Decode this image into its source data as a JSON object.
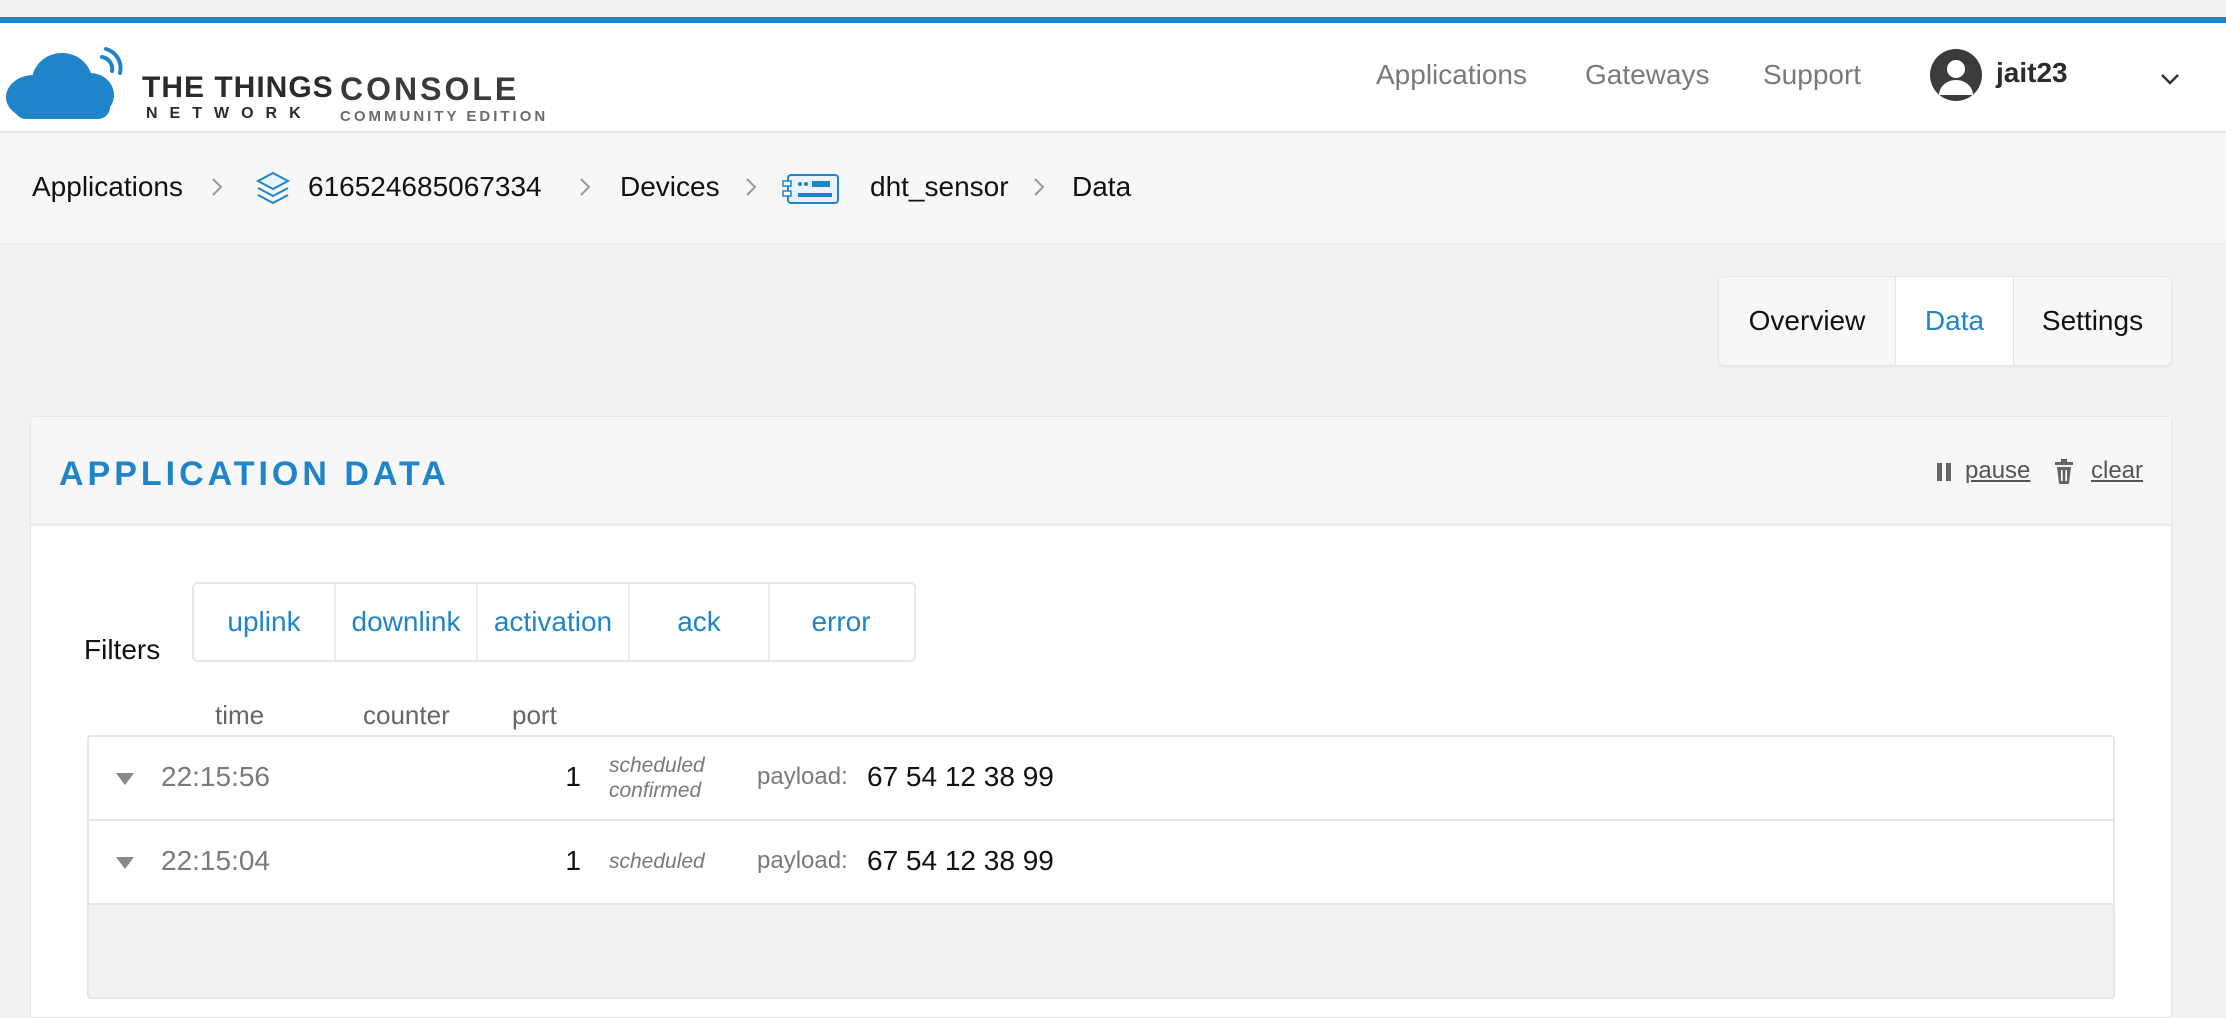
{
  "colors": {
    "accent": "#1f85c8",
    "text": "#111111",
    "muted": "#7a7a7a",
    "page_bg": "#f2f2f2"
  },
  "brand": {
    "line1": "THE THINGS",
    "line2": "NETWORK",
    "product": "CONSOLE",
    "edition": "COMMUNITY EDITION",
    "icon": "ttn-cloud-logo-icon"
  },
  "nav": {
    "items": [
      {
        "label": "Applications"
      },
      {
        "label": "Gateways"
      },
      {
        "label": "Support"
      }
    ],
    "user": {
      "name": "jait23",
      "icon": "user-avatar-icon",
      "menu_icon": "chevron-down-icon"
    }
  },
  "breadcrumb": {
    "items": [
      {
        "label": "Applications"
      },
      {
        "label": "616524685067334",
        "icon": "application-stack-icon"
      },
      {
        "label": "Devices"
      },
      {
        "label": "dht_sensor",
        "icon": "device-icon"
      },
      {
        "label": "Data"
      }
    ]
  },
  "tabs": {
    "items": [
      {
        "label": "Overview"
      },
      {
        "label": "Data"
      },
      {
        "label": "Settings"
      }
    ],
    "active": "Data"
  },
  "panel": {
    "title": "APPLICATION DATA",
    "pause_label": "pause",
    "clear_label": "clear"
  },
  "filters": {
    "label": "Filters",
    "items": [
      "uplink",
      "downlink",
      "activation",
      "ack",
      "error"
    ]
  },
  "table": {
    "columns": [
      "time",
      "counter",
      "port"
    ],
    "rows": [
      {
        "time": "22:15:56",
        "port": "1",
        "status_line1": "scheduled",
        "status_line2": "confirmed",
        "payload_label": "payload:",
        "payload": "67 54 12 38 99"
      },
      {
        "time": "22:15:04",
        "port": "1",
        "status_line1": "scheduled",
        "status_line2": "",
        "payload_label": "payload:",
        "payload": "67 54 12 38 99"
      }
    ]
  }
}
